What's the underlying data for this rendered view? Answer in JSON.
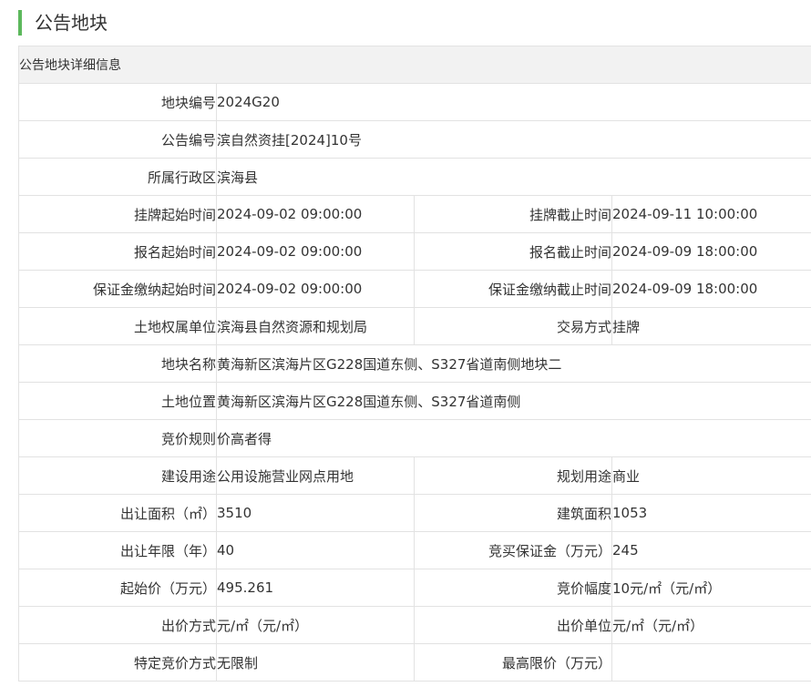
{
  "header": {
    "title": "公告地块"
  },
  "table": {
    "caption": "公告地块详细信息",
    "rows": [
      {
        "label": "地块编号",
        "value": "2024G20"
      },
      {
        "label": "公告编号",
        "value": "滨自然资挂[2024]10号"
      },
      {
        "label": "所属行政区",
        "value": "滨海县"
      },
      {
        "label": "挂牌起始时间",
        "value": "2024-09-02 09:00:00",
        "label2": "挂牌截止时间",
        "value2": "2024-09-11 10:00:00"
      },
      {
        "label": "报名起始时间",
        "value": "2024-09-02 09:00:00",
        "label2": "报名截止时间",
        "value2": "2024-09-09 18:00:00"
      },
      {
        "label": "保证金缴纳起始时间",
        "value": "2024-09-02 09:00:00",
        "label2": "保证金缴纳截止时间",
        "value2": "2024-09-09 18:00:00"
      },
      {
        "label": "土地权属单位",
        "value": "滨海县自然资源和规划局",
        "label2": "交易方式",
        "value2": "挂牌"
      },
      {
        "label": "地块名称",
        "value": "黄海新区滨海片区G228国道东侧、S327省道南侧地块二"
      },
      {
        "label": "土地位置",
        "value": "黄海新区滨海片区G228国道东侧、S327省道南侧"
      },
      {
        "label": "竞价规则",
        "value": "价高者得"
      },
      {
        "label": "建设用途",
        "value": "公用设施营业网点用地",
        "label2": "规划用途",
        "value2": "商业"
      },
      {
        "label": "出让面积（㎡）",
        "value": "3510",
        "label2": "建筑面积",
        "value2": "1053"
      },
      {
        "label": "出让年限（年）",
        "value": "40",
        "label2": "竞买保证金（万元）",
        "value2": "245"
      },
      {
        "label": "起始价（万元）",
        "value": "495.261",
        "label2": "竞价幅度",
        "value2": "10元/㎡（元/㎡）"
      },
      {
        "label": "出价方式",
        "value": "元/㎡（元/㎡）",
        "label2": "出价单位",
        "value2": "元/㎡（元/㎡）"
      },
      {
        "label": "特定竞价方式",
        "value": "无限制",
        "label2": "最高限价（万元）",
        "value2": ""
      }
    ]
  }
}
